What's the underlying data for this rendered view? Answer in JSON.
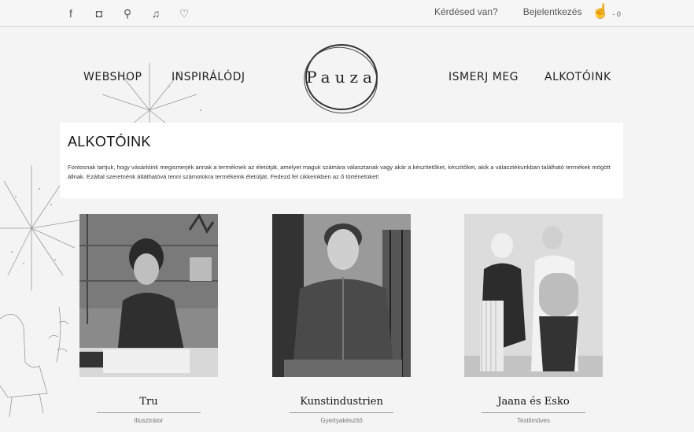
{
  "topbar": {
    "social_icons": [
      "facebook-icon",
      "instagram-icon",
      "pinterest-icon",
      "music-icon",
      "heart-icon"
    ],
    "question_link": "Kérdésed van?",
    "login_link": "Bejelentkezés",
    "cart_count": "0"
  },
  "nav": {
    "webshop": "WEBSHOP",
    "inspiration": "INSPIRÁLÓDJ",
    "logo_text": "Pauza",
    "about": "ISMERJ MEG",
    "creators": "ALKOTÓINK"
  },
  "intro": {
    "title": "ALKOTÓINK",
    "text": "Fontosnak tartjuk, hogy vásárlóink megismerjék annak a terméknek az életútját, amelyet maguk számára választanak vagy akár a készítetőket, készítőket, akik a választékunkban található termékek mögött állnak. Ezáltal szeretnénk átláthatóvá tenni számotokra termékeink életútját. Fedezd fel cikkeinkben az ő történetüket!"
  },
  "creators": [
    {
      "name": "Tru",
      "role": "Illusztrátor"
    },
    {
      "name": "Kunstindustrien",
      "role": "Gyertyakészítő"
    },
    {
      "name": "Jaana és Esko",
      "role": "Textilműves"
    }
  ]
}
